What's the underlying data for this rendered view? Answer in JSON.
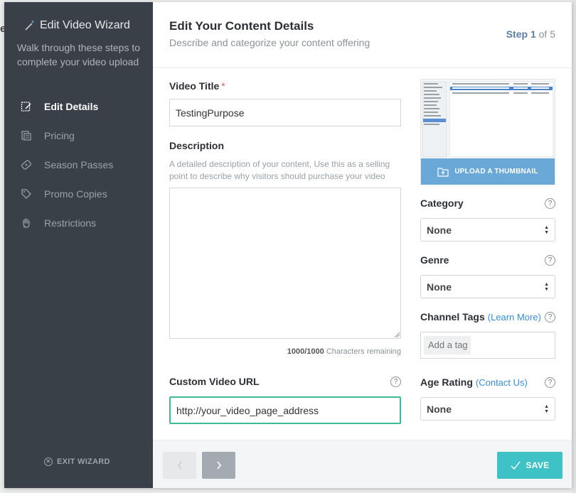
{
  "backdrop": {
    "peek_text": "e"
  },
  "wizard": {
    "title": "Edit Video Wizard",
    "subtitle": "Walk through these steps to complete your video upload",
    "nav": [
      {
        "label": "Edit Details",
        "icon": "edit-details-icon",
        "active": true
      },
      {
        "label": "Pricing",
        "icon": "pricing-icon",
        "active": false
      },
      {
        "label": "Season Passes",
        "icon": "season-pass-icon",
        "active": false
      },
      {
        "label": "Promo Copies",
        "icon": "promo-tag-icon",
        "active": false
      },
      {
        "label": "Restrictions",
        "icon": "hand-icon",
        "active": false
      }
    ],
    "exit_label": "EXIT WIZARD"
  },
  "header": {
    "title": "Edit Your Content Details",
    "subtitle": "Describe and categorize your content offering",
    "step_prefix": "Step",
    "step_current": "1",
    "step_suffix": "of 5"
  },
  "form": {
    "video_title_label": "Video Title",
    "video_title_required": "*",
    "video_title_value": "TestingPurpose",
    "description_label": "Description",
    "description_hint": "A detailed description of your content, Use this as a selling point to describe why visitors should purchase your video",
    "description_value": "",
    "chars_count": "1000/1000",
    "chars_suffix": "Characters remaining",
    "custom_url_label": "Custom Video URL",
    "custom_url_value": "http://your_video_page_address",
    "help_glyph": "?"
  },
  "thumbnail": {
    "upload_label": "UPLOAD A THUMBNAIL"
  },
  "category": {
    "label": "Category",
    "value": "None"
  },
  "genre": {
    "label": "Genre",
    "value": "None"
  },
  "channel_tags": {
    "label": "Channel Tags",
    "link": "(Learn More)",
    "placeholder": "Add a tag"
  },
  "age_rating": {
    "label": "Age Rating",
    "link": "(Contact Us)",
    "value": "None"
  },
  "footer": {
    "save_label": "SAVE"
  },
  "colors": {
    "sidebar": "#3a4048",
    "accent_save": "#3fc2c5",
    "link": "#3a8ed6",
    "thumb_button": "#6aa8d8",
    "url_focus_border": "#3fb89a"
  }
}
